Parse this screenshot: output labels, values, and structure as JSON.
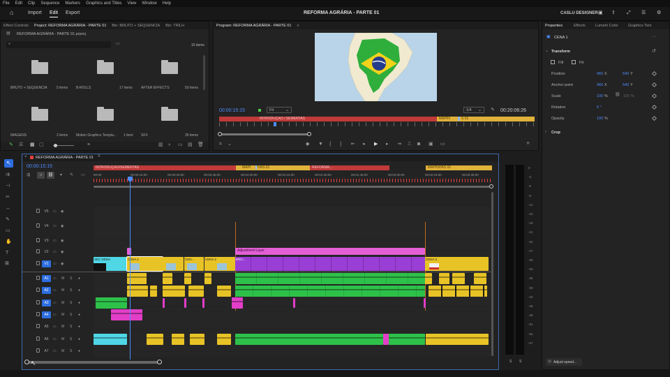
{
  "menu": [
    "File",
    "Edit",
    "Clip",
    "Sequence",
    "Markers",
    "Graphics and Titles",
    "View",
    "Window",
    "Help"
  ],
  "appbar": {
    "import": "Import",
    "edit": "Edit",
    "export": "Export",
    "title": "REFORMA AGRÁRIA - PARTE 01",
    "user": "CASLU DESIGNER"
  },
  "left_tabs": [
    "Effect Controls",
    "Project: REFORMA AGRÁRIA - PARTE 01",
    "Bin: BRUTO + SEQUENCIA",
    "Bin: TRILH"
  ],
  "project": {
    "file": "REFORMA AGRÁRIA - PARTE 01.prproj",
    "items_count": "15 items",
    "bins": [
      {
        "name": "BRUTO + SEQUENCIA",
        "count": "5 items"
      },
      {
        "name": "B-ROLLS",
        "count": "17 items"
      },
      {
        "name": "AFTER EFFECTS",
        "count": "50 items"
      },
      {
        "name": "IMAGENS",
        "count": "2 items"
      },
      {
        "name": "Motion Graphics Templa...",
        "count": "1 item"
      },
      {
        "name": "SFX",
        "count": "35 items"
      }
    ]
  },
  "program": {
    "tab": "Program: REFORMA AGRÁRIA - PARTE 01",
    "timecode": "00:00:15:15",
    "fit": "Fit",
    "resolution": "1/4",
    "duration": "00:20:06:26",
    "marker_red": "INTRODUÇÃO / SEMENTAS",
    "marker_yellow": "MAPIN",
    "marker_blue": "S 01"
  },
  "timeline": {
    "tab": "REFORMA AGRÁRIA - PARTE 01",
    "timecode": "00:00:15:15",
    "ruler": [
      "00:00",
      "00:00:15:00",
      "00:00:30:00",
      "00:00:45:00",
      "00:01:00:00",
      "00:01:15:00",
      "00:01:30:00",
      "00:01:45:00",
      "00:02:00:00",
      "00:02:15:00",
      "00:02:30:00"
    ],
    "markers": {
      "red1": "INTRODUÇÃO/SEMENTAS",
      "yellow1": "MAPI",
      "yellow1b": "HAS 01",
      "red2": "REFORMA...",
      "yellow2": "MAPINHAS 02"
    },
    "video_tracks": [
      "V5",
      "V4",
      "V3",
      "V2",
      "V1"
    ],
    "audio_tracks": [
      "A1",
      "A2",
      "A3",
      "A4",
      "A5",
      "A6",
      "A7"
    ],
    "clips": {
      "v1a": "SEC DEMA",
      "v1b": "CENA 1",
      "v1c": "CEN...",
      "v1d": "CENA 2",
      "adj": "Adjustment Layer",
      "v1e": "CENA 3",
      "bro": "BRO..."
    }
  },
  "properties": {
    "tabs": [
      "Properties",
      "Effects",
      "Lumetri Color",
      "Graphics Tem"
    ],
    "clip": "CENA 1",
    "section": "Transform",
    "fill": "Fill",
    "fit": "Fit",
    "position_label": "Position",
    "pos_x": "960",
    "pos_x_unit": "X",
    "pos_y": "540",
    "pos_y_unit": "Y",
    "anchor_label": "Anchor point",
    "anc_x": "960",
    "anc_y": "540",
    "scale_label": "Scale",
    "scale": "100",
    "scale_unit": "%",
    "scale2": "100",
    "rotation_label": "Rotation",
    "rotation": "0",
    "rotation_unit": "°",
    "opacity_label": "Opacity",
    "opacity": "100",
    "opacity_unit": "%",
    "crop": "Crop",
    "adjust": "Adjust speed..."
  },
  "meter": [
    "0",
    "-3",
    "-6",
    "-9",
    "-12",
    "-15",
    "-18",
    "-21",
    "-24",
    "-27",
    "-30",
    "-33",
    "-36",
    "-39",
    "-42",
    "-45",
    "-48",
    "-51",
    "-54",
    "-57"
  ],
  "meter_solo": [
    "S",
    "S"
  ],
  "colors": {
    "accent": "#2d6de0",
    "marker_red": "#c03a3a",
    "marker_yellow": "#e0b23a",
    "clip_cyan": "#4fd7e6",
    "clip_yellow": "#e8c326",
    "clip_purple": "#9a3fd6",
    "clip_pink": "#e23ec8",
    "clip_green": "#2ec14a",
    "playhead": "#4d8cff"
  }
}
